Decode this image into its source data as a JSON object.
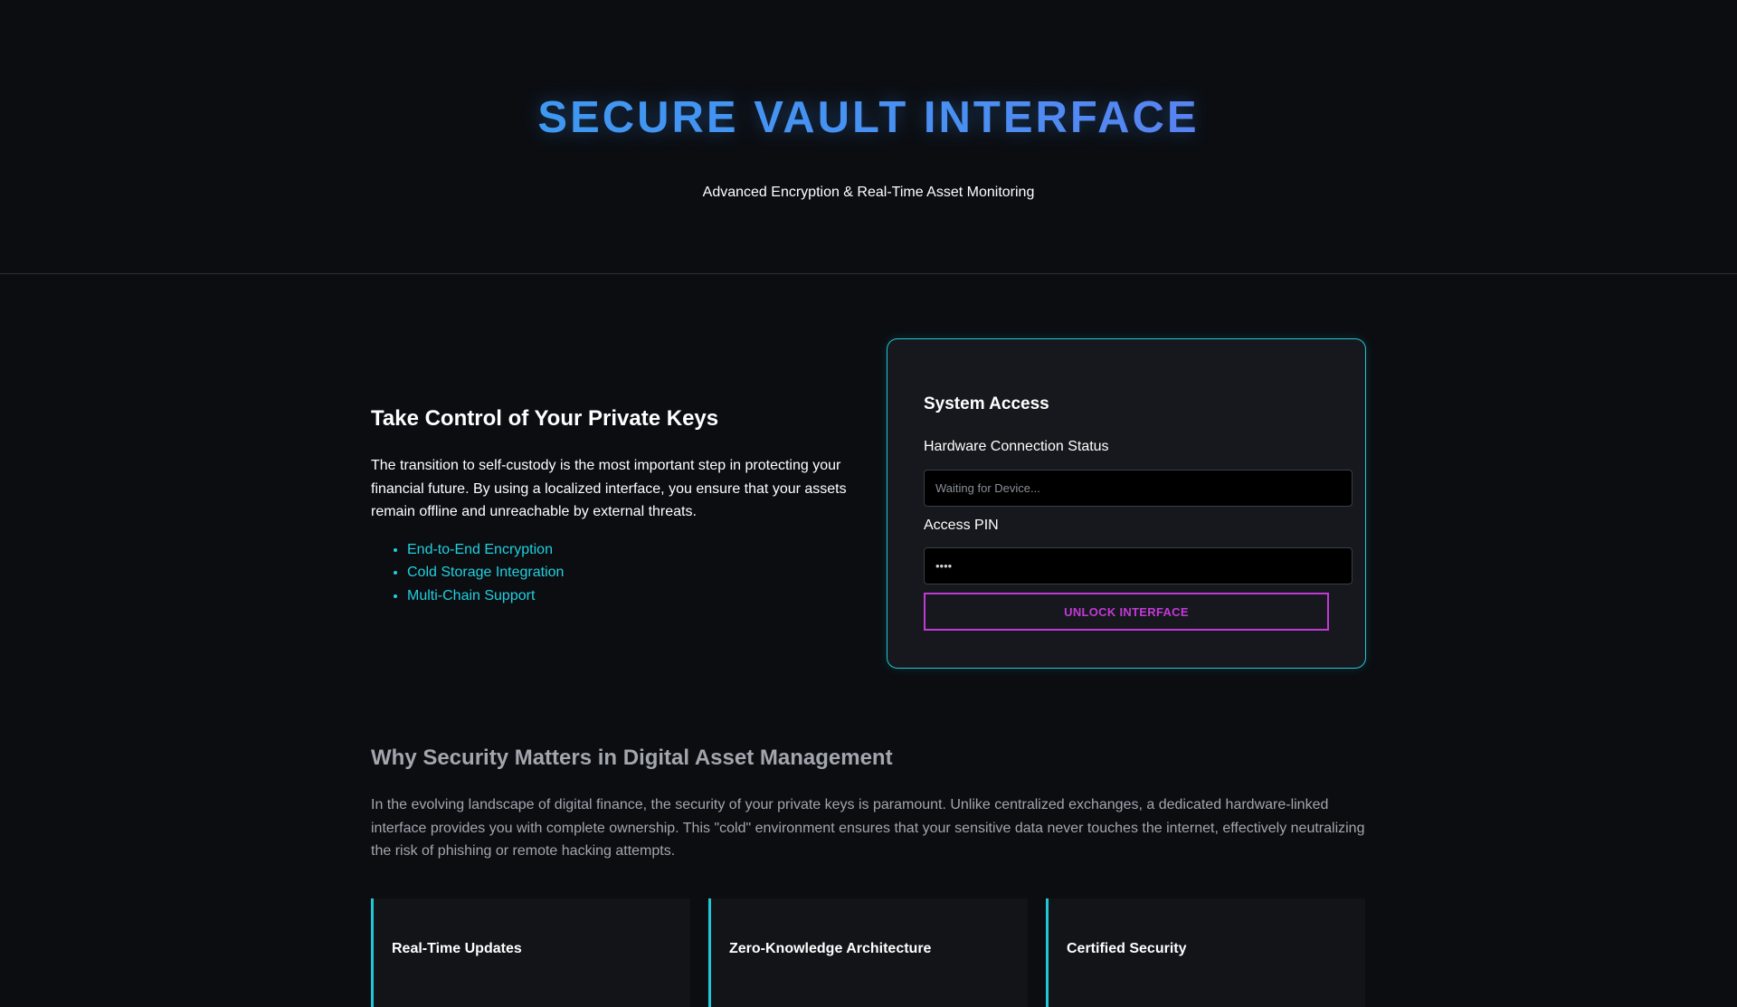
{
  "header": {
    "title": "SECURE VAULT INTERFACE",
    "subtitle": "Advanced Encryption & Real-Time Asset Monitoring"
  },
  "intro": {
    "heading": "Take Control of Your Private Keys",
    "body": "The transition to self-custody is the most important step in protecting your financial future. By using a localized interface, you ensure that your assets remain offline and unreachable by external threats.",
    "features": [
      "End-to-End Encryption",
      "Cold Storage Integration",
      "Multi-Chain Support"
    ]
  },
  "access_card": {
    "title": "System Access",
    "hardware_label": "Hardware Connection Status",
    "hardware_placeholder": "Waiting for Device...",
    "pin_label": "Access PIN",
    "pin_value": "••••",
    "unlock_label": "UNLOCK INTERFACE"
  },
  "why": {
    "heading": "Why Security Matters in Digital Asset Management",
    "body": "In the evolving landscape of digital finance, the security of your private keys is paramount. Unlike centralized exchanges, a dedicated hardware-linked interface provides you with complete ownership. This \"cold\" environment ensures that your sensitive data never touches the internet, effectively neutralizing the risk of phishing or remote hacking attempts."
  },
  "feature_cards": [
    {
      "title": "Real-Time Updates"
    },
    {
      "title": "Zero-Knowledge Architecture"
    },
    {
      "title": "Certified Security"
    }
  ],
  "colors": {
    "background": "#0b0d11",
    "accent_cyan": "#1ec8d8",
    "accent_magenta": "#c23ad6",
    "title_gradient_start": "#2fa3f0",
    "title_gradient_end": "#7a68f0"
  }
}
